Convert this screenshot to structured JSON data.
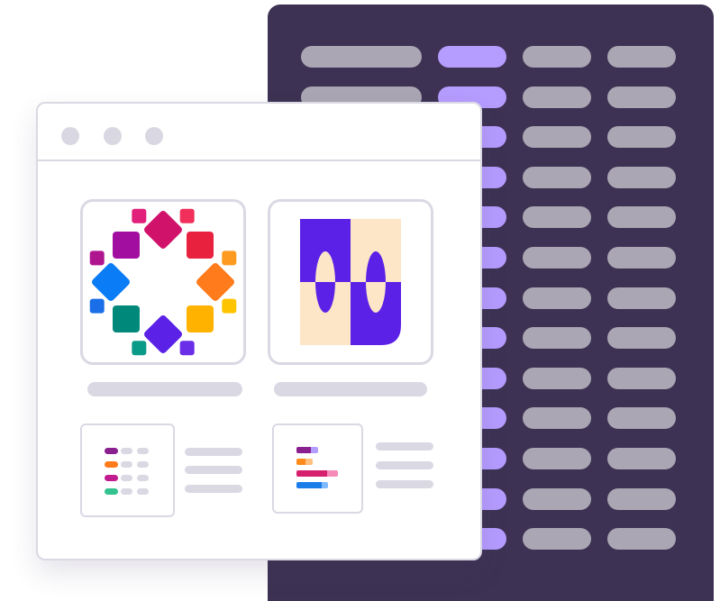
{
  "colors": {
    "panel": "#3d3253",
    "pill_gray": "#aaa6b3",
    "pill_purple": "#b59cff",
    "window_border": "#dad8e3",
    "placeholder": "#dad8e3",
    "accent_purple": "#5b21e6",
    "accent_cream": "#fde6c8"
  },
  "panel": {
    "rows": 13,
    "columns": [
      "wide-gray",
      "purple",
      "gray",
      "gray"
    ]
  },
  "window": {
    "title_dots": 3,
    "cards": [
      {
        "name": "color-wheel-logo",
        "icon": "flower-logo-icon"
      },
      {
        "name": "abstract-petal-logo",
        "icon": "petal-pattern-icon"
      }
    ],
    "thumbnails": [
      {
        "name": "list-thumbnail",
        "icon": "color-list-icon",
        "swatches": [
          "#8a1f8f",
          "#ff7a1a",
          "#c21a8f",
          "#34c38f"
        ]
      },
      {
        "name": "bar-chart-thumbnail",
        "icon": "bar-chart-icon",
        "swatches": [
          "#8a1f8f",
          "#ff8a1a",
          "#d6206e",
          "#1a7de8"
        ]
      }
    ]
  }
}
